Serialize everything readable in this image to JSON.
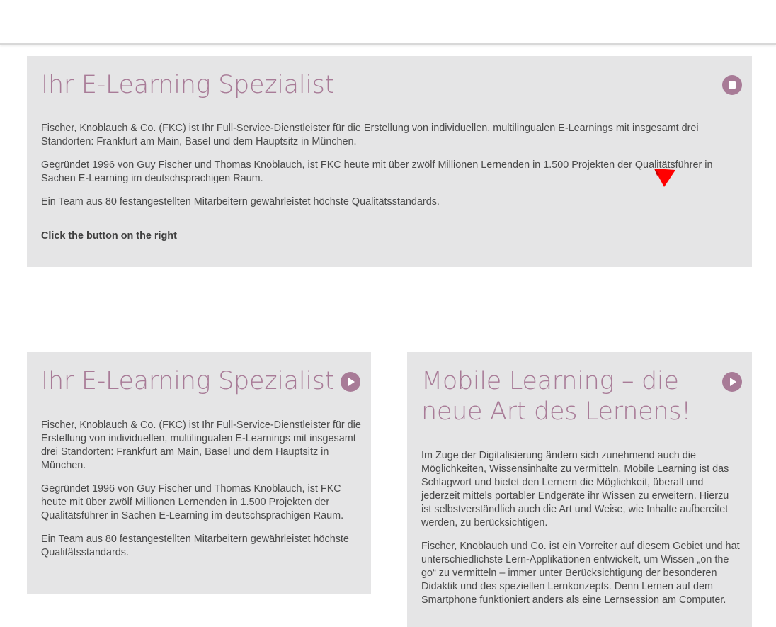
{
  "cards": [
    {
      "title": "Ihr E-Learning Spezialist",
      "button_icon": "stop-icon",
      "paragraphs": [
        "Fischer, Knoblauch & Co. (FKC) ist Ihr Full-Service-Dienstleister für die Erstellung von individuellen, multilingualen E-Learnings mit insgesamt drei Standorten: Frankfurt am Main, Basel und dem Hauptsitz in München.",
        "Gegründet 1996 von Guy Fischer und Thomas Knoblauch, ist FKC heute mit über zwölf Millionen Lernenden in 1.500 Projekten der Qualitätsführer in Sachen E-Learning im deutschsprachigen Raum.",
        "Ein Team aus 80 festangestellten Mitarbeitern gewährleistet höchste Qualitätsstandards."
      ],
      "cta": "Click the button on the right"
    },
    {
      "title": "Ihr E-Learning Spezialist",
      "button_icon": "play-icon",
      "paragraphs": [
        "Fischer, Knoblauch & Co. (FKC) ist Ihr Full-Service-Dienstleister für die Erstellung von individuellen, multilingualen E-Learnings mit insgesamt drei Standorten: Frankfurt am Main, Basel und dem Hauptsitz in München.",
        "Gegründet 1996 von Guy Fischer und Thomas Knoblauch, ist FKC heute mit über zwölf Millionen Lernenden in 1.500 Projekten der Qualitätsführer in Sachen E-Learning im deutschsprachigen Raum.",
        "Ein Team aus 80 festangestellten Mitarbeitern gewährleistet höchste Qualitätsstandards."
      ]
    },
    {
      "title": "Mobile Learning – die neue Art des Lernens!",
      "button_icon": "play-icon",
      "paragraphs": [
        "Im Zuge der Digitalisierung ändern sich zunehmend auch die Möglichkeiten, Wissensinhalte zu vermitteln. Mobile Learning ist das Schlagwort und bietet den Lernern die Möglichkeit, überall und jederzeit mittels portabler Endgeräte ihr Wissen zu erweitern. Hierzu ist selbstverständlich auch die Art und Weise, wie Inhalte aufbereitet werden, zu berücksichtigen.",
        "Fischer, Knoblauch und Co. ist ein Vorreiter auf diesem Gebiet und hat unterschiedlichste Lern-Applikationen entwickelt, um Wissen „on the go“ zu vermitteln – immer unter Berücksichtigung der besonderen Didaktik und des speziellen Lernkonzepts. Denn Lernen auf dem Smartphone funktioniert anders als eine Lernsession am Computer."
      ]
    }
  ],
  "colors": {
    "accent": "#a87b97",
    "card_background": "#e5e5e6",
    "cursor": "#ff0000"
  }
}
